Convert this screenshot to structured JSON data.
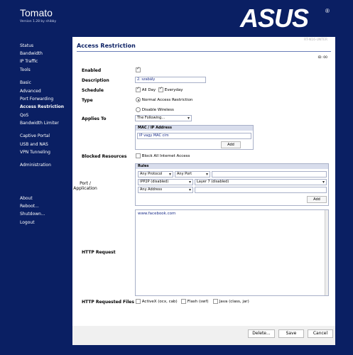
{
  "header": {
    "brand": "Tomato",
    "version": "Version 1.28 by shibby",
    "logo_text": "ASUS",
    "logo_trademark": "®"
  },
  "sidebar": {
    "items": [
      {
        "label": "Status"
      },
      {
        "label": "Bandwidth"
      },
      {
        "label": "IP Traffic"
      },
      {
        "label": "Tools"
      },
      {
        "label": "Basic"
      },
      {
        "label": "Advanced"
      },
      {
        "label": "Port Forwarding"
      },
      {
        "label": "Access Restriction",
        "active": true
      },
      {
        "label": "QoS"
      },
      {
        "label": "Bandwidth Limiter"
      },
      {
        "label": "Captive Portal"
      },
      {
        "label": "USB and NAS"
      },
      {
        "label": "VPN Tunneling"
      },
      {
        "label": "Administration"
      },
      {
        "label": "About"
      },
      {
        "label": "Reboot..."
      },
      {
        "label": "Shutdown..."
      },
      {
        "label": "Logout"
      }
    ]
  },
  "main": {
    "top_right": "RT-N16-UNTER",
    "top_code": "ID: 00",
    "title": "Access Restriction",
    "enabled_label": "Enabled",
    "enabled": true,
    "description_label": "Description",
    "description_value": "2. szabály",
    "schedule_label": "Schedule",
    "schedule_allday": "All Day",
    "schedule_everyday": "Everyday",
    "type_label": "Type",
    "type_normal": "Normal Access Restriction",
    "type_wireless": "Disable Wireless",
    "applies_label": "Applies To",
    "applies_select": "The Following...",
    "mac_header": "MAC / IP Address",
    "mac_placeholder": "IP vagy MAC cím",
    "add_label": "Add",
    "blocked_label": "Blocked Resources",
    "block_all_label": "Block All Internet Access",
    "rules_header": "Rules",
    "port_label_1": "Port /",
    "port_label_2": "Application",
    "any_protocol": "Any Protocol",
    "any_port": "Any Port",
    "ipp2p": "IPP2P (disabled)",
    "layer7": "Layer 7 (disabled)",
    "any_address": "Any Address",
    "http_label": "HTTP Request",
    "http_value": "www.facebook.com",
    "files_label": "HTTP Requested Files",
    "files": [
      "ActiveX (ocx, cab)",
      "Flash (swf)",
      "Java (class, jar)"
    ]
  },
  "footer": {
    "delete_label": "Delete...",
    "save_label": "Save",
    "cancel_label": "Cancel"
  },
  "colors": {
    "background": "#0a1f63",
    "title": "#0a1f63",
    "content": "#ffffff"
  }
}
